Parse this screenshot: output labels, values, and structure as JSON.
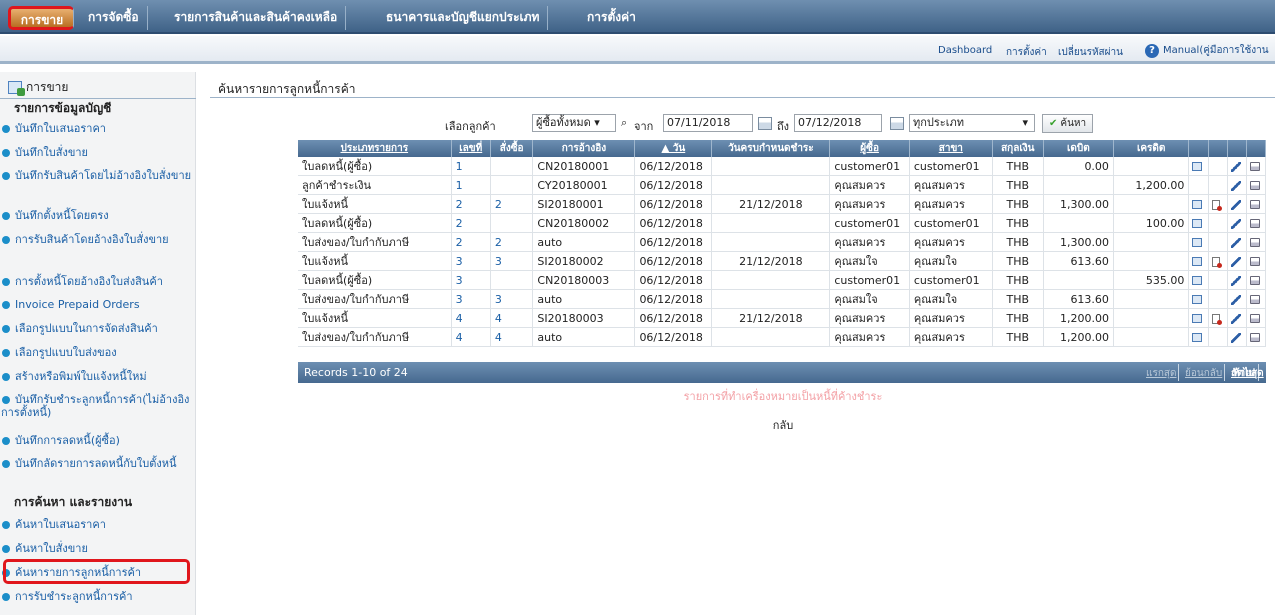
{
  "top_nav": {
    "tabs": [
      "การขาย",
      "การจัดซื้อ",
      "รายการสินค้าและสินค้าคงเหลือ",
      "ธนาคารและบัญชีแยกประเภท",
      "การตั้งค่า"
    ],
    "active_tab": "การขาย"
  },
  "sub_bar": {
    "links": [
      "Dashboard",
      "การตั้งค่า",
      "เปลี่ยนรหัสผ่าน"
    ],
    "manual": "Manual(คู่มือการใช้งาน"
  },
  "sidebar": {
    "title": "การขาย",
    "section1": "รายการข้อมูลบัญชี",
    "items1": [
      "บันทึกใบเสนอราคา",
      "บันทึกใบสั่งขาย",
      "บันทึกรับสินค้าโดยไม่อ้างอิงใบสั่งขาย",
      "บันทึกตั้งหนี้โดยตรง",
      "การรับสินค้าโดยอ้างอิงใบสั่งขาย",
      "การตั้งหนี้โดยอ้างอิงใบส่งสินค้า",
      "Invoice Prepaid Orders",
      "เลือกรูปแบบในการจัดส่งสินค้า",
      "เลือกรูปแบบใบส่งของ",
      "สร้างหรือพิมพ์ใบแจ้งหนี้ใหม่",
      "บันทึกรับชำระลูกหนี้การค้า(ไม่อ้างอิงการตั้งหนี้)",
      "บันทึกการลดหนี้(ผู้ซื้อ)",
      "บันทึกลัดรายการลดหนี้กับใบตั้งหนี้"
    ],
    "section2": "การค้นหา และรายงาน",
    "items2": [
      "ค้นหาใบเสนอราคา",
      "ค้นหาใบสั่งขาย",
      "ค้นหารายการลูกหนี้การค้า",
      "การรับชำระลูกหนี้การค้า"
    ]
  },
  "main": {
    "title": "ค้นหารายการลูกหนี้การค้า",
    "filters": {
      "customer_label": "เลือกลูกค้า",
      "customer_value": "ผู้ซื้อทั้งหมด",
      "from_label": "จาก",
      "from_date": "07/11/2018",
      "to_label": "ถึง",
      "to_date": "07/12/2018",
      "type_value": "ทุกประเภท",
      "search_button": "ค้นหา"
    },
    "columns": [
      "ประเภทรายการ",
      "เลขที่",
      "สั่งซื้อ",
      "การอ้างอิง",
      "▲ วัน",
      "วันครบกำหนดชำระ",
      "ผู้ซื้อ",
      "สาขา",
      "สกุลเงิน",
      "เดบิต",
      "เครดิต"
    ],
    "rows": [
      [
        "ใบลดหนี้(ผู้ซื้อ)",
        "1",
        "",
        "CN20180001",
        "06/12/2018",
        "",
        "customer01",
        "customer01",
        "THB",
        "0.00",
        ""
      ],
      [
        "ลูกค้าชำระเงิน",
        "1",
        "",
        "CY20180001",
        "06/12/2018",
        "",
        "คุณสมควร",
        "คุณสมควร",
        "THB",
        "",
        "1,200.00"
      ],
      [
        "ใบแจ้งหนี้",
        "2",
        "2",
        "SI20180001",
        "06/12/2018",
        "21/12/2018",
        "คุณสมควร",
        "คุณสมควร",
        "THB",
        "1,300.00",
        ""
      ],
      [
        "ใบลดหนี้(ผู้ซื้อ)",
        "2",
        "",
        "CN20180002",
        "06/12/2018",
        "",
        "customer01",
        "customer01",
        "THB",
        "",
        "100.00"
      ],
      [
        "ใบส่งของ/ใบกำกับภาษี",
        "2",
        "2",
        "auto",
        "06/12/2018",
        "",
        "คุณสมควร",
        "คุณสมควร",
        "THB",
        "1,300.00",
        ""
      ],
      [
        "ใบแจ้งหนี้",
        "3",
        "3",
        "SI20180002",
        "06/12/2018",
        "21/12/2018",
        "คุณสมใจ",
        "คุณสมใจ",
        "THB",
        "613.60",
        ""
      ],
      [
        "ใบลดหนี้(ผู้ซื้อ)",
        "3",
        "",
        "CN20180003",
        "06/12/2018",
        "",
        "customer01",
        "customer01",
        "THB",
        "",
        "535.00"
      ],
      [
        "ใบส่งของ/ใบกำกับภาษี",
        "3",
        "3",
        "auto",
        "06/12/2018",
        "",
        "คุณสมใจ",
        "คุณสมใจ",
        "THB",
        "613.60",
        ""
      ],
      [
        "ใบแจ้งหนี้",
        "4",
        "4",
        "SI20180003",
        "06/12/2018",
        "21/12/2018",
        "คุณสมควร",
        "คุณสมควร",
        "THB",
        "1,200.00",
        ""
      ],
      [
        "ใบส่งของ/ใบกำกับภาษี",
        "4",
        "4",
        "auto",
        "06/12/2018",
        "",
        "คุณสมควร",
        "คุณสมควร",
        "THB",
        "1,200.00",
        ""
      ]
    ],
    "row_icons": [
      [
        "note-icon",
        "pencil-icon",
        "printer-icon"
      ],
      [
        "pencil-icon",
        "printer-icon"
      ],
      [
        "note-icon",
        "pdf-icon",
        "pencil-icon",
        "printer-icon"
      ],
      [
        "note-icon",
        "pencil-icon",
        "printer-icon"
      ],
      [
        "note-icon",
        "pencil-icon",
        "printer-icon"
      ],
      [
        "note-icon",
        "pdf-icon",
        "pencil-icon",
        "printer-icon"
      ],
      [
        "note-icon",
        "pencil-icon",
        "printer-icon"
      ],
      [
        "note-icon",
        "pencil-icon",
        "printer-icon"
      ],
      [
        "note-icon",
        "pdf-icon",
        "pencil-icon",
        "printer-icon"
      ],
      [
        "note-icon",
        "pencil-icon",
        "printer-icon"
      ]
    ],
    "pager": {
      "records": "Records 1-10 of 24",
      "first": "แรกสุด",
      "prev": "ย้อนกลับ",
      "next": "ถัดไป",
      "last": "ท้ายสุด"
    },
    "note": "รายการที่ทำเครื่องหมายเป็นหนี้ที่ค้างชำระ",
    "back": "กลับ"
  }
}
